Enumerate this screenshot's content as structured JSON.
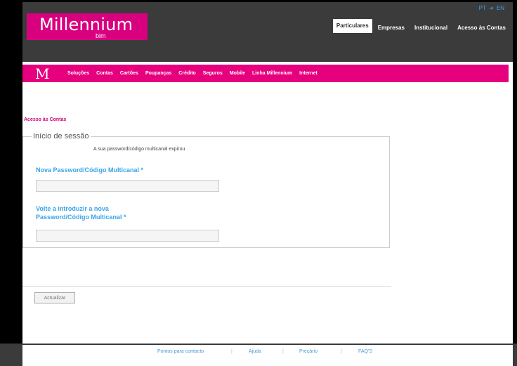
{
  "header": {
    "logo": {
      "name": "Millennium",
      "sub": "bim"
    },
    "lang": {
      "pt": "PT",
      "en": "EN"
    },
    "tabs": [
      {
        "label": "Particulares",
        "active": true
      },
      {
        "label": "Empresas",
        "active": false
      },
      {
        "label": "Institucional",
        "active": false
      },
      {
        "label": "Acesso às Contas",
        "active": false
      }
    ]
  },
  "menu": {
    "logo": "M",
    "items": [
      "Soluções",
      "Contas",
      "Cartões",
      "Poupanças",
      "Crédito",
      "Seguros",
      "Mobile",
      "Linha Millennium",
      "Internet"
    ]
  },
  "breadcrumb": "Acesso às Contas",
  "session": {
    "legend": "Início de sessão",
    "message": "A sua password/código multicanal expirou",
    "field1_label": "Nova Password/Código Multicanal *",
    "field2_label_line1": "Volte a introduzir a nova",
    "field2_label_line2": "Password/Código Multicanal *",
    "field1_value": "",
    "field2_value": ""
  },
  "button": "Actualizar",
  "footer": {
    "links": [
      "Pontos para contacto",
      "Ajuda",
      "Preçário",
      "FAQ'S"
    ],
    "separator": "|"
  },
  "colors": {
    "brand": "#e6007e",
    "header_bg": "#3b3b3b",
    "link": "#3aa3e8"
  }
}
